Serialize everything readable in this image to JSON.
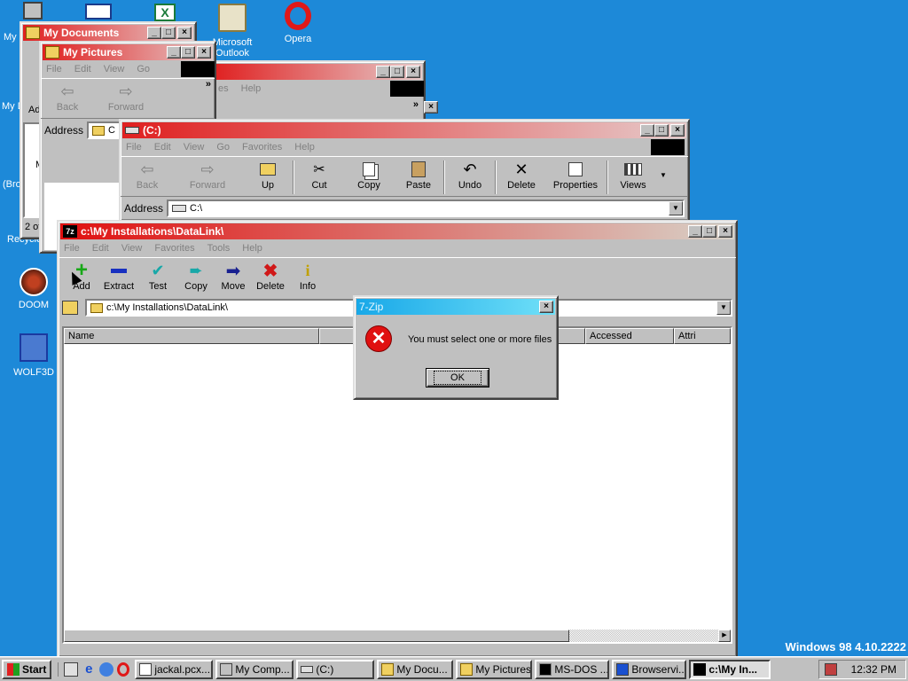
{
  "desktop": {
    "icons": [
      {
        "label": "My",
        "icon": "my-computer-icon"
      },
      {
        "label": "Microsoft Outlook",
        "icon": "outlook-icon"
      },
      {
        "label": "Opera",
        "icon": "opera-icon"
      },
      {
        "label": "DOOM",
        "icon": "doom-icon"
      },
      {
        "label": "WOLF3D",
        "icon": "wolf3d-icon"
      }
    ],
    "partial_labels": [
      "My D",
      "(Bro",
      "Recycle"
    ],
    "version_text": "Windows 98 4.10.2222"
  },
  "win_mydocs": {
    "title": "My Documents",
    "status": "2 of",
    "address_label": "Ad",
    "partial_m": "M"
  },
  "win_mypics": {
    "title": "My Pictures",
    "menu": [
      "File",
      "Edit",
      "View",
      "Go"
    ],
    "toolbar": {
      "back": "Back",
      "forward": "Forward",
      "chevron": "»"
    },
    "address_label": "Address",
    "address_value": "C"
  },
  "win_mid": {
    "menu_partial": [
      "es",
      "Help"
    ],
    "chevron": "»"
  },
  "win_c": {
    "title": "(C:)",
    "menu": [
      "File",
      "Edit",
      "View",
      "Go",
      "Favorites",
      "Help"
    ],
    "toolbar": [
      "Back",
      "Forward",
      "Up",
      "Cut",
      "Copy",
      "Paste",
      "Undo",
      "Delete",
      "Properties",
      "Views"
    ],
    "address_label": "Address",
    "address_value": "C:\\"
  },
  "win_7zip": {
    "title": "c:\\My Installations\\DataLink\\",
    "title_icon": "7z",
    "menu": [
      "File",
      "Edit",
      "View",
      "Favorites",
      "Tools",
      "Help"
    ],
    "toolbar": [
      "Add",
      "Extract",
      "Test",
      "Copy",
      "Move",
      "Delete",
      "Info"
    ],
    "path": "c:\\My Installations\\DataLink\\",
    "columns": [
      "Name",
      "",
      "",
      "",
      "Accessed",
      "Attri"
    ]
  },
  "dialog": {
    "title": "7-Zip",
    "message": "You must select one or more files",
    "ok": "OK"
  },
  "taskbar": {
    "start": "Start",
    "buttons": [
      "jackal.pcx...",
      "My Comp...",
      "(C:)",
      "My Docu...",
      "My Pictures",
      "MS-DOS ...",
      "Browservi...",
      "c:\\My In..."
    ],
    "clock": "12:32 PM"
  }
}
